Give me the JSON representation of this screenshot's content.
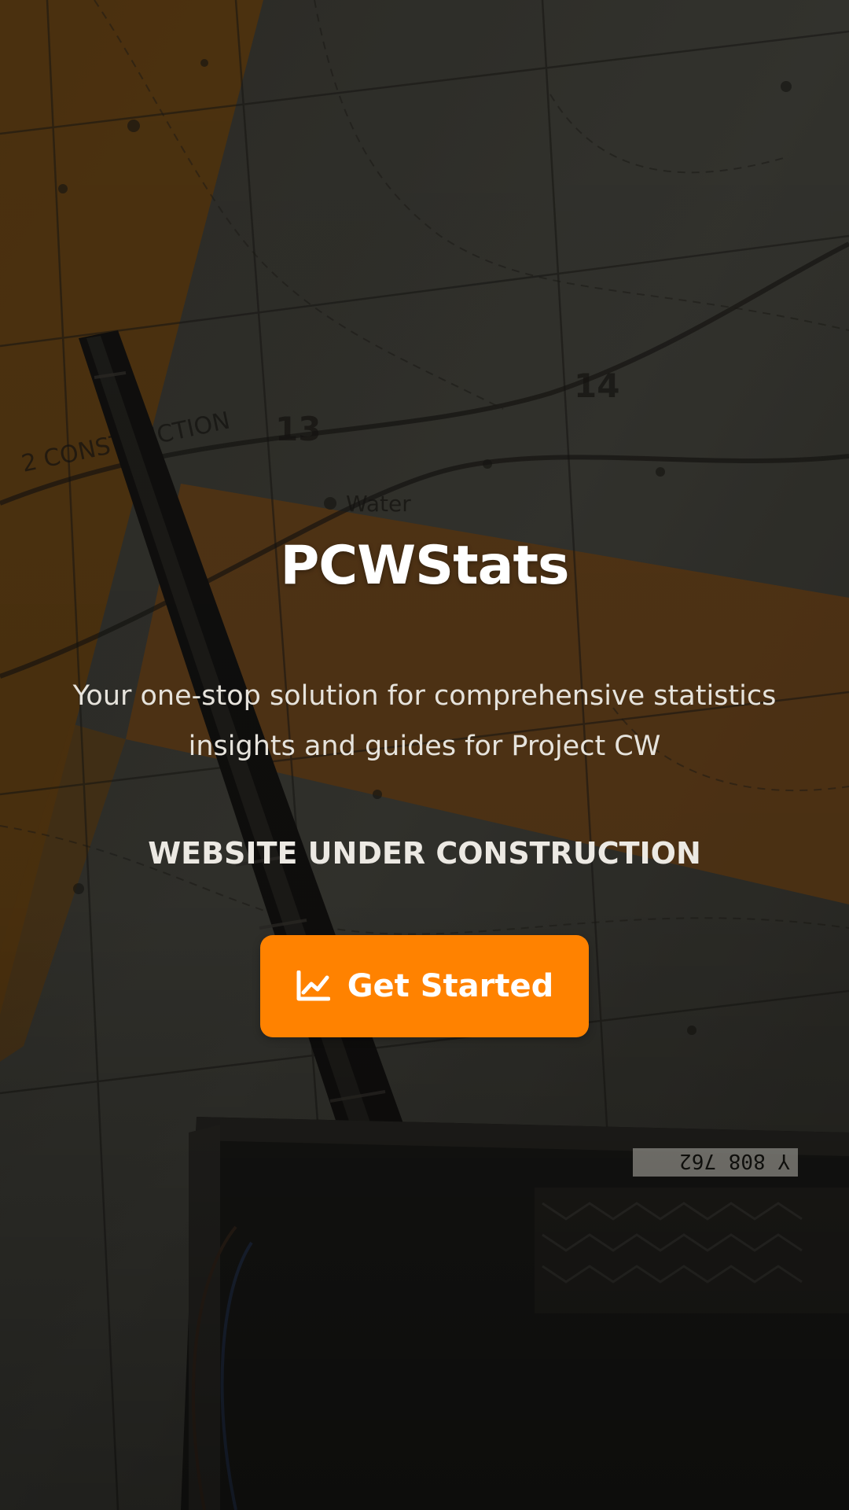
{
  "colors": {
    "accent": "#ff8200",
    "background_overlay": "#2e2c27"
  },
  "hero": {
    "title": "PCWStats",
    "subtitle": "Your one-stop solution for comprehensive statistics insights and guides for Project CW",
    "status": "WEBSITE UNDER CONSTRUCTION",
    "cta": {
      "label": "Get Started",
      "icon": "chart-line-icon"
    }
  },
  "background_labels": [
    "CONSTRUCTION",
    "Water",
    "14",
    "13",
    "Y 808 762"
  ]
}
